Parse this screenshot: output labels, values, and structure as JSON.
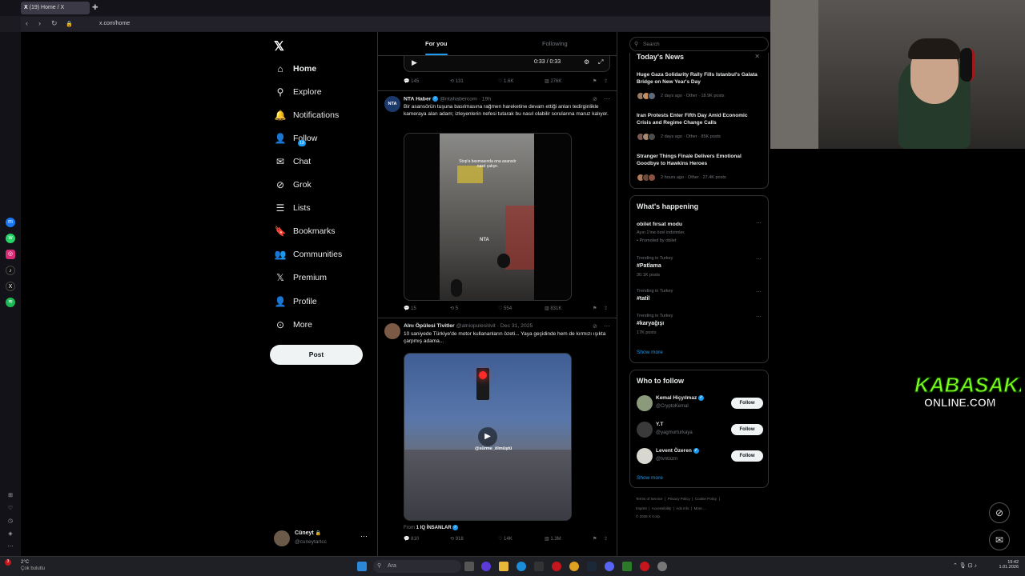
{
  "browser": {
    "tab_title": "(19) Home / X",
    "url": "x.com/home"
  },
  "nav": {
    "items": [
      {
        "label": "Home",
        "icon": "home-icon",
        "glyph": "⌂"
      },
      {
        "label": "Explore",
        "icon": "search-icon",
        "glyph": "⚲"
      },
      {
        "label": "Notifications",
        "icon": "bell-icon",
        "glyph": "🔔"
      },
      {
        "label": "Follow",
        "icon": "person-add-icon",
        "glyph": "👤"
      },
      {
        "label": "Chat",
        "icon": "mail-icon",
        "glyph": "✉"
      },
      {
        "label": "Grok",
        "icon": "grok-icon",
        "glyph": "⊘"
      },
      {
        "label": "Lists",
        "icon": "lists-icon",
        "glyph": "☰"
      },
      {
        "label": "Bookmarks",
        "icon": "bookmark-icon",
        "glyph": "🔖"
      },
      {
        "label": "Communities",
        "icon": "communities-icon",
        "glyph": "👥"
      },
      {
        "label": "Premium",
        "icon": "x-premium-icon",
        "glyph": "𝕏"
      },
      {
        "label": "Profile",
        "icon": "profile-icon",
        "glyph": "👤"
      },
      {
        "label": "More",
        "icon": "more-circle-icon",
        "glyph": "⊙"
      }
    ],
    "notifications_badge": "19",
    "post_label": "Post",
    "user": {
      "name": "Cüneyt",
      "handle": "@cuneytartcc"
    }
  },
  "timeline": {
    "tabs": [
      "For you",
      "Following"
    ],
    "video_time": "0:33 / 0:33",
    "top_stats": {
      "replies": "145",
      "reposts": "131",
      "likes": "1.6K",
      "views": "276K"
    },
    "tweets": [
      {
        "name": "NTA Haber",
        "handle": "@ntahabercom",
        "time": "19h",
        "text": "Bir asansörün tuşuna basılmasına rağmen hareketine devam ettiği anları tedirginlikle kameraya alan adam; izleyenlerin nefesi tutarak bu nasıl olabilir sorularına maruz kalıyor.",
        "video_caption": "Stop'a basmasında ona asansör nasıl çalışır.",
        "watermark": "NTA",
        "stats": {
          "replies": "15",
          "reposts": "5",
          "likes": "554",
          "views": "831K"
        }
      },
      {
        "name": "Alnı Öpülesi Tivitler",
        "handle": "@alniopulesitivit",
        "time": "Dec 31, 2025",
        "text": "10 saniyede Türkiye'de motor kullananların özeti... Yaya geçidinde hem de kırmızı ışıkta çarpmış adama...",
        "video_caption": "@sürme_ölmüştü",
        "from_label": "From",
        "from_source": "1 IQ İNSANLAR",
        "stats": {
          "replies": "810",
          "reposts": "918",
          "likes": "14K",
          "views": "1.3M"
        }
      }
    ]
  },
  "sidebar": {
    "search_placeholder": "Search",
    "news_title": "Today's News",
    "news": [
      {
        "title": "Huge Gaza Solidarity Rally Fills Istanbul's Galata Bridge on New Year's Day",
        "meta": "2 days ago · Other · 18.9K posts"
      },
      {
        "title": "Iran Protests Enter Fifth Day Amid Economic Crisis and Regime Change Calls",
        "meta": "2 days ago · Other · 85K posts"
      },
      {
        "title": "Stranger Things Finale Delivers Emotional Goodbye to Hawkins Heroes",
        "meta": "2 hours ago · Other · 27.4K posts"
      }
    ],
    "happening_title": "What's happening",
    "promo": {
      "title": "obilet fırsat modu",
      "desc": "Ayın 1'ine özel indirimler.",
      "promoted": "Promoted by obilet"
    },
    "trends": [
      {
        "context": "Trending in Turkey",
        "name": "#Patlama",
        "posts": "30.1K posts"
      },
      {
        "context": "Trending in Turkey",
        "name": "#tatil",
        "posts": ""
      },
      {
        "context": "Trending in Turkey",
        "name": "#karyağışı",
        "posts": "17K posts"
      }
    ],
    "show_more": "Show more",
    "wtf_title": "Who to follow",
    "wtf": [
      {
        "name": "Kemal Hiçyılmaz",
        "handle": "@CryptoKemal",
        "verified": true
      },
      {
        "name": "Y.T",
        "handle": "@yagmurturkaya",
        "verified": false
      },
      {
        "name": "Levent Özeren",
        "handle": "@tvntozrn",
        "verified": true
      }
    ],
    "follow_label": "Follow",
    "footer_line1": [
      "Terms of Service",
      "Privacy Policy",
      "Cookie Policy"
    ],
    "footer_line2": [
      "Imprint",
      "Accessibility",
      "Ads info",
      "More ..."
    ],
    "copyright": "© 2026 X Corp."
  },
  "overlay": {
    "logo_line1": "KABASAKAL",
    "logo_line2": "ONLINE.COM"
  },
  "taskbar": {
    "weather_temp": "2°C",
    "weather_desc": "Çok bulutlu",
    "search_label": "Ara",
    "time": "19:42",
    "date": "1.01.2026"
  },
  "colors": {
    "accent": "#1d9bf0",
    "background": "#000000",
    "text": "#e7e9ea",
    "muted": "#71767b",
    "logo_green": "#7cff1a"
  }
}
